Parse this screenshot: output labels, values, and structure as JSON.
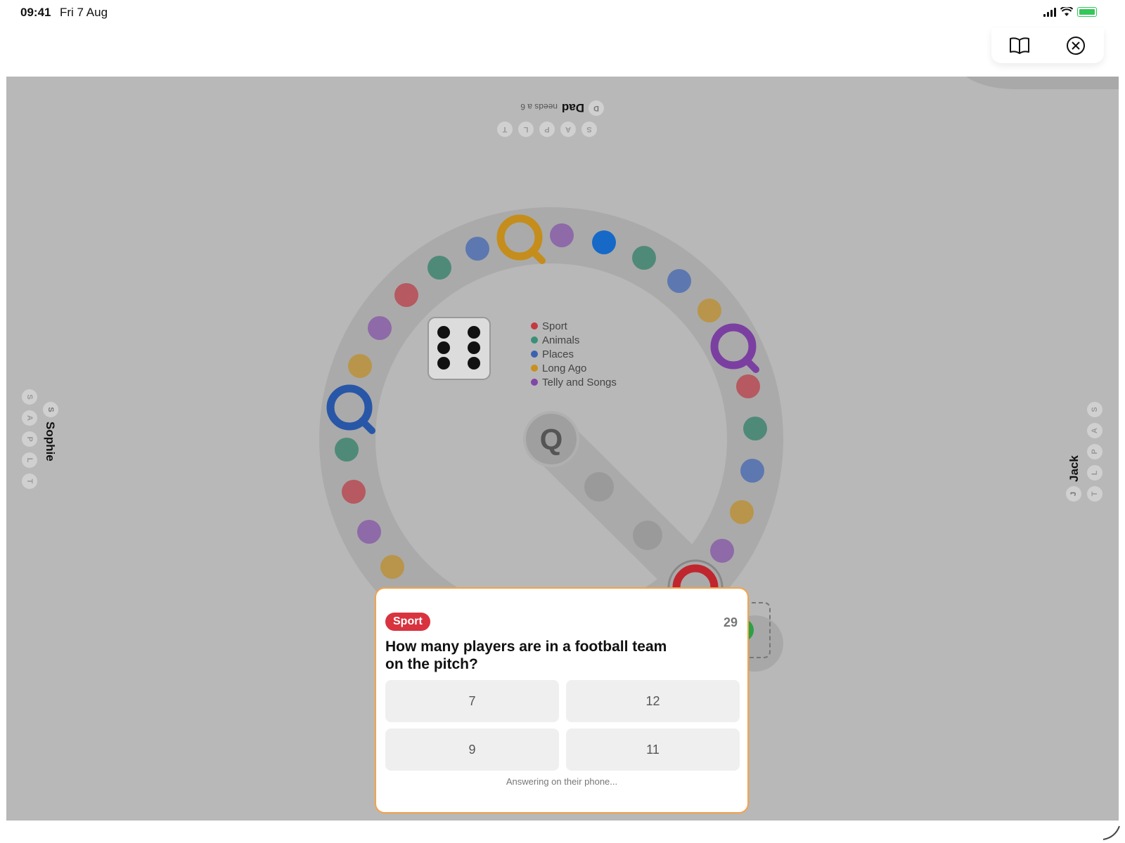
{
  "status": {
    "time": "09:41",
    "date": "Fri 7 Aug"
  },
  "top_icons": [
    "book-icon",
    "close-circle-icon"
  ],
  "players": {
    "top": {
      "name": "Dad",
      "initial": "D",
      "needs": "needs a 6",
      "letters": [
        "S",
        "A",
        "P",
        "L",
        "T"
      ]
    },
    "left": {
      "name": "Sophie",
      "initial": "S",
      "letters": [
        "S",
        "A",
        "P",
        "L",
        "T"
      ]
    },
    "right": {
      "name": "Jack",
      "initial": "J",
      "letters": [
        "T",
        "L",
        "P",
        "A",
        "S"
      ]
    }
  },
  "legend": [
    {
      "label": "Sport",
      "color": "#c23b42"
    },
    {
      "label": "Animals",
      "color": "#3a8f78"
    },
    {
      "label": "Places",
      "color": "#3b62b0"
    },
    {
      "label": "Long Ago",
      "color": "#c9901f"
    },
    {
      "label": "Telly and Songs",
      "color": "#8047a6"
    }
  ],
  "dice": {
    "value": 6
  },
  "center_letter": "Q",
  "question_card": {
    "category": "Sport",
    "timer": "29",
    "question": "How many players are in a football team on the pitch?",
    "answers": [
      "7",
      "12",
      "9",
      "11"
    ],
    "status": "Answering on their phone..."
  }
}
